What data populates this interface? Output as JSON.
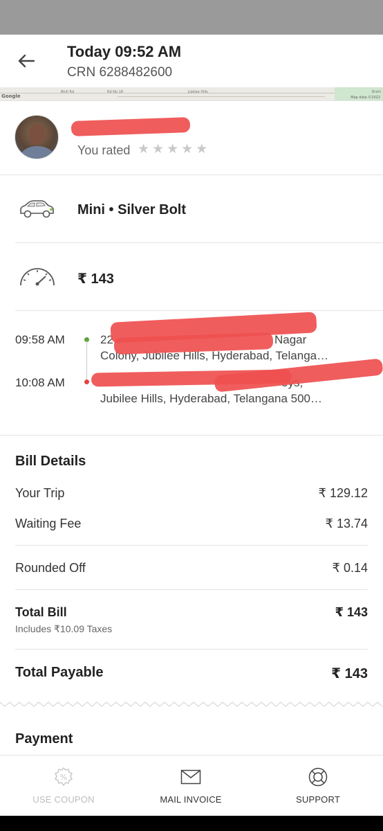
{
  "header": {
    "title": "Today 09:52 AM",
    "subtitle": "CRN 6288482600"
  },
  "map": {
    "google_label": "Google",
    "credit": "Map data ©2022",
    "labels": [
      "Bhill Rd",
      "Rd No 18",
      "Jubilee Hills",
      "Brahi"
    ]
  },
  "driver": {
    "rated_label": "You rated",
    "stars_total": 5,
    "stars_filled": 0,
    "star_glyph": "★"
  },
  "cab": {
    "description": "Mini • Silver Bolt"
  },
  "fare": {
    "amount": "₹ 143"
  },
  "trip": {
    "pickup_time": "09:58 AM",
    "pickup_address_line1": "22",
    "pickup_address_line1_tail": "Nagar",
    "pickup_address_line2": "Colony, Jubilee Hills, Hyderabad, Telanga…",
    "drop_time": "10:08 AM",
    "drop_address_line1_tail": "eys,",
    "drop_address_line2": "Jubilee Hills, Hyderabad, Telangana 500…",
    "pickup_color": "#5aa33c",
    "drop_color": "#e04545"
  },
  "bill": {
    "title": "Bill Details",
    "rows": [
      {
        "label": "Your Trip",
        "value": "₹ 129.12"
      },
      {
        "label": "Waiting Fee",
        "value": "₹ 13.74"
      },
      {
        "label": "Rounded Off",
        "value": "₹ 0.14"
      }
    ],
    "total_label": "Total Bill",
    "total_value": "₹ 143",
    "taxes_note": "Includes ₹10.09 Taxes",
    "payable_label": "Total Payable",
    "payable_value": "₹ 143"
  },
  "payment": {
    "title": "Payment"
  },
  "bottom_bar": {
    "coupon_label": "USE COUPON",
    "mail_label": "MAIL INVOICE",
    "support_label": "SUPPORT"
  },
  "colors": {
    "redaction": "#ef4f4f",
    "status_bar": "#9a9a9a"
  }
}
